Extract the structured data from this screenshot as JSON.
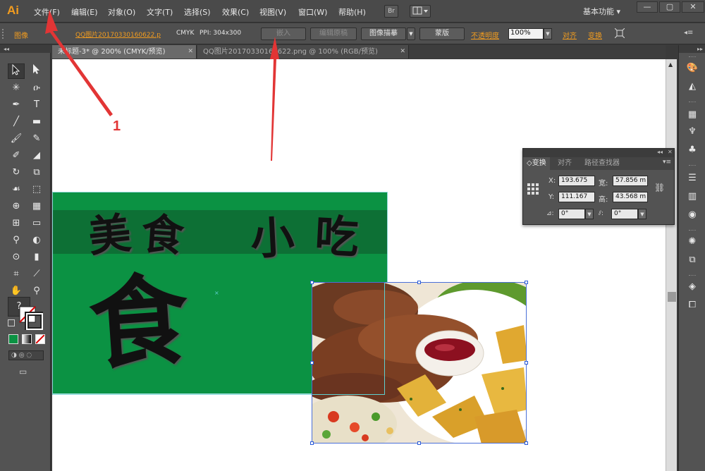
{
  "app": {
    "logo": "Ai"
  },
  "menubar": {
    "items": [
      "文件(F)",
      "编辑(E)",
      "对象(O)",
      "文字(T)",
      "选择(S)",
      "效果(C)",
      "视图(V)",
      "窗口(W)",
      "帮助(H)"
    ],
    "bridge_label": "Br",
    "workspace": "基本功能 ▾",
    "window_buttons": [
      "—",
      "▢",
      "✕"
    ]
  },
  "controlbar": {
    "object_type": "图像",
    "file_link": "QQ图片20170330160622.p",
    "color_mode": "CMYK",
    "ppi": "PPI: 304x300",
    "embed_button": "嵌入",
    "edit_original_button": "编辑原稿",
    "image_trace_button": "图像描摹",
    "mask_button": "蒙版",
    "opacity_label": "不透明度",
    "opacity_value": "100%",
    "align_label": "对齐",
    "transform_label": "变换"
  },
  "tabs": [
    {
      "label": "未标题-3* @ 200% (CMYK/预览)",
      "close": "✕"
    },
    {
      "label": "QQ图片20170330160622.png @ 100% (RGB/预览)",
      "close": "✕"
    }
  ],
  "artwork": {
    "headline_chars": [
      "美",
      "食",
      "小",
      "吃"
    ],
    "big_char": "食"
  },
  "annotation": {
    "label": "1"
  },
  "transform_panel": {
    "tabs": [
      "◇变换",
      "对齐",
      "路径查找器"
    ],
    "x_label": "X:",
    "x_value": "193.675",
    "w_label": "宽:",
    "w_value": "57.856 m",
    "y_label": "Y:",
    "y_value": "111.167",
    "h_label": "高:",
    "h_value": "43.568 m",
    "rotate_value": "0°",
    "shear_value": "0°"
  },
  "toolbar": {
    "help": "?"
  },
  "colors": {
    "accent": "#f29c1f",
    "artboard_green": "#0b9243",
    "annotation_red": "#e23535"
  }
}
